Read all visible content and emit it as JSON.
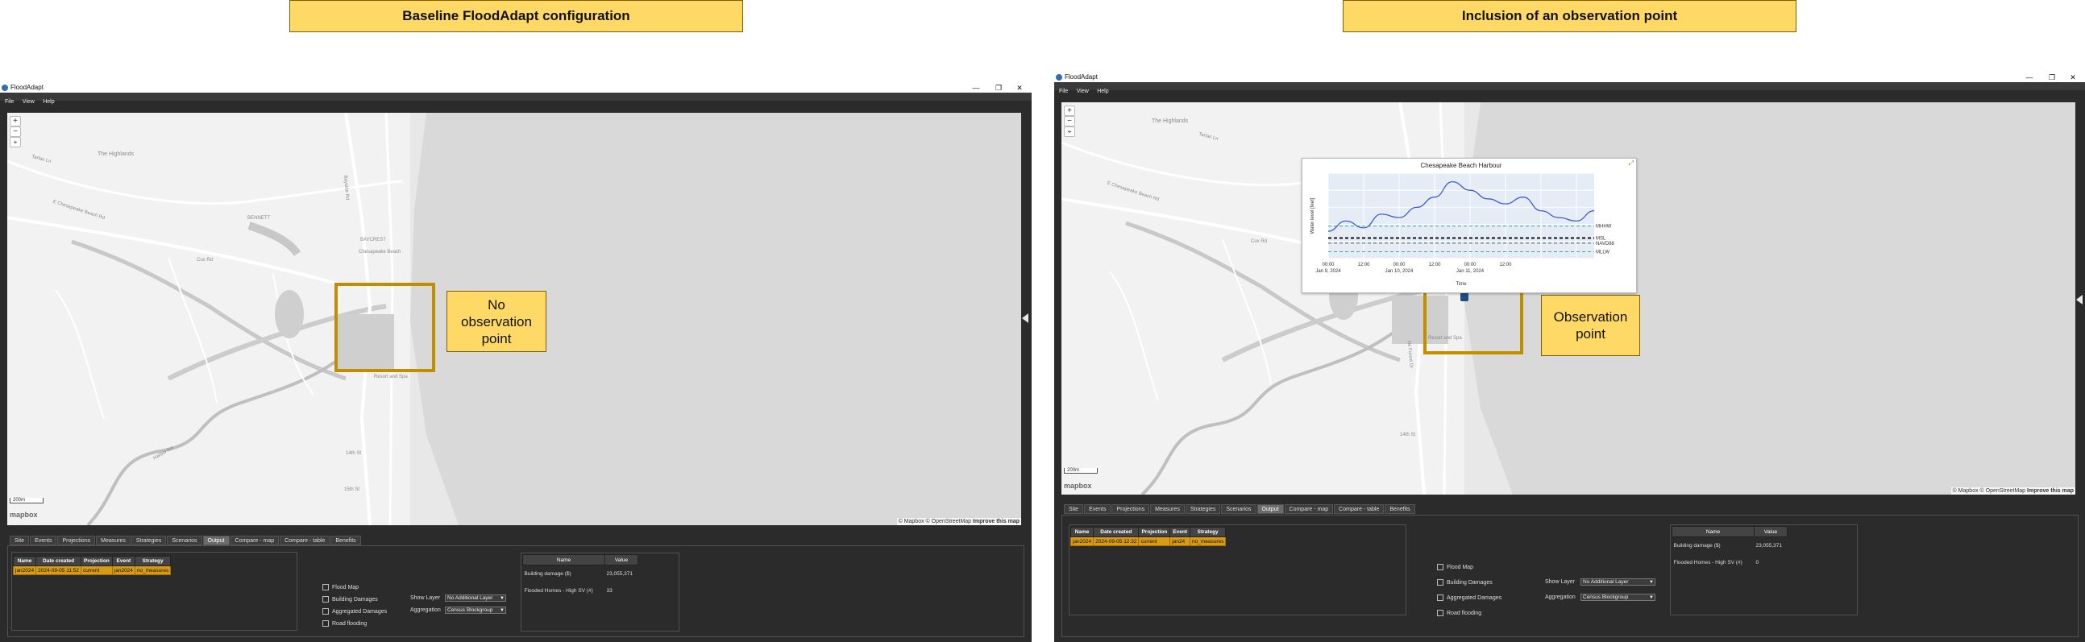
{
  "annotations": {
    "left_title": "Baseline FloodAdapt configuration",
    "right_title": "Inclusion of an observation point",
    "left_callout": [
      "No",
      "observation",
      "point"
    ],
    "right_callout": [
      "Observation",
      "point"
    ]
  },
  "app": {
    "window_title": "FloodAdapt",
    "window_controls": {
      "minimize": "—",
      "restore": "❐",
      "close": "✕"
    },
    "menu": [
      "File",
      "View",
      "Help"
    ]
  },
  "map": {
    "zoom_in": "+",
    "zoom_out": "−",
    "compass": "⌖",
    "scale_label": "200m",
    "logo": "mapbox",
    "attribution": {
      "mapbox": "© Mapbox",
      "osm": "© OpenStreetMap",
      "improve": "Improve this map"
    },
    "labels": {
      "highlands": "The Highlands",
      "chesapeake_rd": "E Chesapeake Beach Rd",
      "bennett": "BENNETT",
      "baycrest": "BAYCREST",
      "bayside": "Bayside Rd",
      "harbor": "Harbor Rd",
      "c_beach": "Chesapeake Beach",
      "fourteenth": "14th St",
      "fifteenth": "15th St",
      "resort": "Resort and Spa",
      "tarlan": "Tarlan Ln",
      "cox": "Cox Rd",
      "seaside": "Seaside",
      "de_forest": "De Forest Dr"
    }
  },
  "tabs": [
    "Site",
    "Events",
    "Projections",
    "Measures",
    "Strategies",
    "Scenarios",
    "Output",
    "Compare - map",
    "Compare - table",
    "Benefits"
  ],
  "active_tab": "Output",
  "scenario_table": {
    "headers": [
      "Name",
      "Date created",
      "Projection",
      "Event",
      "Strategy"
    ]
  },
  "left_panel": {
    "scenario_row": [
      "jan2024",
      "2024-09-05 11:52",
      "current",
      "jan2024",
      "no_measures"
    ]
  },
  "right_panel": {
    "scenario_row": [
      "jan2024",
      "2024-09-05 12:32",
      "current",
      "jan24",
      "no_measures"
    ]
  },
  "layers": [
    "Flood Map",
    "Building Damages",
    "Aggregated Damages",
    "Road flooding"
  ],
  "show_layer": {
    "label": "Show Layer",
    "value": "No Additional Layer"
  },
  "aggregation": {
    "label": "Aggregation",
    "value": "Census Blockgroup"
  },
  "metrics": {
    "headers": [
      "Name",
      "Value"
    ],
    "rows": [
      {
        "name": "Building damage ($)",
        "value": "23,055,371"
      },
      {
        "name": "Flooded Homes - High SV (#)",
        "value_left": "33",
        "value_right": "0"
      }
    ]
  },
  "chart_data": {
    "type": "line",
    "title": "Chesapeake Beach Harbour",
    "xlabel": "Time",
    "ylabel": "Water level [feet]",
    "xtick_labels": [
      [
        "00:00",
        "Jan 9, 2024"
      ],
      [
        "12:00",
        ""
      ],
      [
        "00:00",
        "Jan 10, 2024"
      ],
      [
        "12:00",
        ""
      ],
      [
        "00:00",
        "Jan 11, 2024"
      ],
      [
        "12:00",
        ""
      ]
    ],
    "x_hours": [
      0,
      6,
      12,
      18,
      24,
      30,
      36,
      42,
      48,
      54,
      60,
      66,
      72,
      78,
      84,
      90
    ],
    "series": [
      {
        "values": [
          0.6,
          1.2,
          0.8,
          1.6,
          1.4,
          2.0,
          2.6,
          3.5,
          3.0,
          2.5,
          2.2,
          2.6,
          1.8,
          1.4,
          1.2,
          1.8
        ]
      }
    ],
    "reference_lines": [
      {
        "label": "MHHW",
        "value": 0.9,
        "style": "dashed",
        "color": "#3aa7a0"
      },
      {
        "label": "MSL",
        "value": 0.2,
        "style": "dashed",
        "color": "#111111"
      },
      {
        "label": "NAVD88",
        "value": -0.1,
        "style": "dashed",
        "color": "#555555"
      },
      {
        "label": "MLLW",
        "value": -0.6,
        "style": "dashed",
        "color": "#3aa7a0"
      }
    ],
    "grid": true
  },
  "colors": {
    "accent": "#d99a14",
    "annotation_fill": "#ffd966",
    "highlight_border": "#bf8f00",
    "line": "#3d5ccc"
  }
}
